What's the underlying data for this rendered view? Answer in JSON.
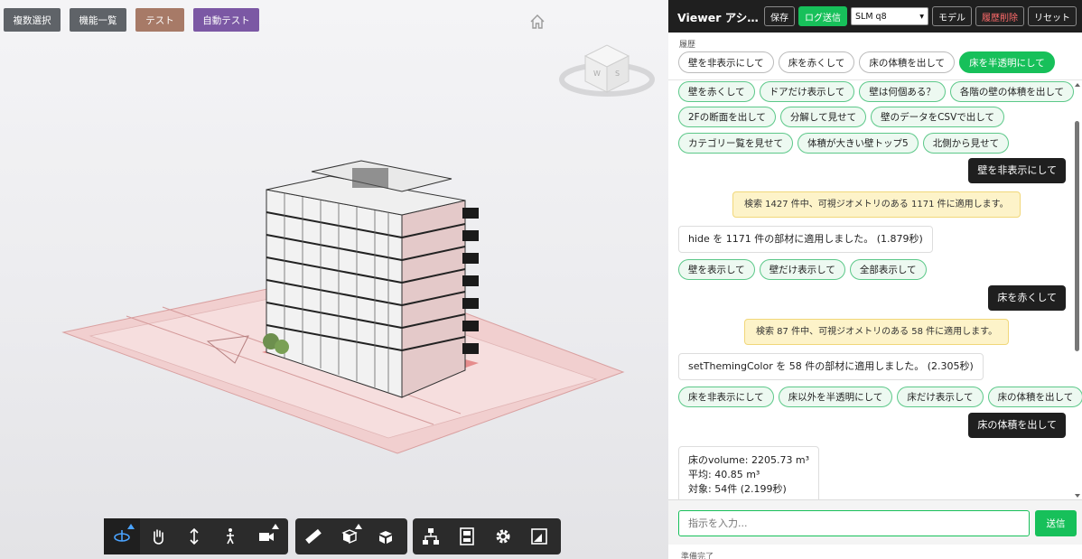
{
  "viewer": {
    "top_buttons": {
      "multi_select": "複数選択",
      "feature_list": "機能一覧",
      "test": "テスト",
      "auto_test": "自動テスト"
    },
    "toolbar_icons": [
      "orbit-icon",
      "pan-icon",
      "dolly-icon",
      "walk-icon",
      "camera-icon",
      "measure-icon",
      "section-icon",
      "explode-icon",
      "model-browser-icon",
      "properties-icon",
      "settings-icon",
      "fullscreen-icon"
    ],
    "colors": {
      "toolbar": "#2b2b2b",
      "floor_tint": "#e8a6a6",
      "active_tool": "#4aa3ff"
    }
  },
  "panel": {
    "title": "Viewer アシ…",
    "buttons": {
      "save": "保存",
      "send_log": "ログ送信",
      "model": "モデル",
      "clear_history": "履歴削除",
      "reset": "リセット"
    },
    "model_select": "SLM q8",
    "history_label": "履歴",
    "history": [
      "壁を非表示にして",
      "床を赤くして",
      "床の体積を出して",
      "床を半透明にして"
    ],
    "suggestions_top": [
      [
        "壁を赤くして",
        "ドアだけ表示して",
        "壁は何個ある？",
        "各階の壁の体積を出して"
      ],
      [
        "2Fの断面を出して",
        "分解して見せて",
        "壁のデータをCSVで出して"
      ],
      [
        "カテゴリー覧を見せて",
        "体積が大きい壁トップ5",
        "北側から見せて"
      ]
    ],
    "messages": {
      "user1": "壁を非表示にして",
      "sys1": "検索 1427 件中、可視ジオメトリのある 1171 件に適用します。",
      "assist1": "hide を 1171 件の部材に適用しました。 (1.879秒)",
      "sugg1": [
        "壁を表示して",
        "壁だけ表示して",
        "全部表示して"
      ],
      "user2": "床を赤くして",
      "sys2": "検索 87 件中、可視ジオメトリのある 58 件に適用します。",
      "assist2": "setThemingColor を 58 件の部材に適用しました。 (2.305秒)",
      "sugg2": [
        "床を非表示にして",
        "床以外を半透明にして",
        "床だけ表示して",
        "床の体積を出して"
      ],
      "user3": "床の体積を出して",
      "assist3": [
        "床のvolume: 2205.73 m³",
        "平均: 40.85 m³",
        "対象: 54件 (2.199秒)"
      ]
    },
    "input_placeholder": "指示を入力...",
    "send": "送信",
    "status": "準備完了",
    "colors": {
      "accent": "#17c05a",
      "header": "#1f1f1f",
      "system_bg": "#fdf3c9"
    }
  }
}
